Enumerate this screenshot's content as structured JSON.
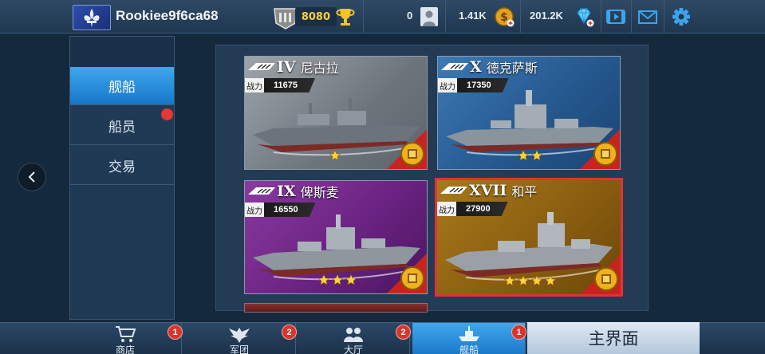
{
  "player": {
    "name": "Rookiee9f6ca68"
  },
  "topbar": {
    "rank_points": "8080",
    "friends_count": "0",
    "coins": "1.41K",
    "diamonds": "201.2K"
  },
  "side_tabs": [
    {
      "label": "舰船",
      "active": true
    },
    {
      "label": "船员",
      "active": false,
      "has_alert": true
    },
    {
      "label": "交易",
      "active": false
    }
  ],
  "ships": [
    {
      "tier": "IV",
      "name": "尼古拉",
      "power_label": "战力",
      "power": "11675",
      "stars": 1,
      "theme": "gray"
    },
    {
      "tier": "X",
      "name": "德克萨斯",
      "power_label": "战力",
      "power": "17350",
      "stars": 2,
      "theme": "blue"
    },
    {
      "tier": "IX",
      "name": "俾斯麦",
      "power_label": "战力",
      "power": "16550",
      "stars": 3,
      "theme": "purple"
    },
    {
      "tier": "XVII",
      "name": "和平",
      "power_label": "战力",
      "power": "27900",
      "stars": 4,
      "theme": "gold",
      "selected": true
    }
  ],
  "bottom_tabs": [
    {
      "label": "商店",
      "badge": "1",
      "icon": "cart-icon"
    },
    {
      "label": "军团",
      "badge": "2",
      "icon": "eagle-icon"
    },
    {
      "label": "大厅",
      "badge": "2",
      "icon": "people-icon"
    },
    {
      "label": "舰船",
      "badge": "1",
      "icon": "ship-icon",
      "active": true
    }
  ],
  "home_button": {
    "label": "主界面"
  },
  "colors": {
    "accent": "#2a90e0",
    "alert": "#e23a2f",
    "selected_border": "#e33232",
    "gold": "#ffcf3a"
  }
}
